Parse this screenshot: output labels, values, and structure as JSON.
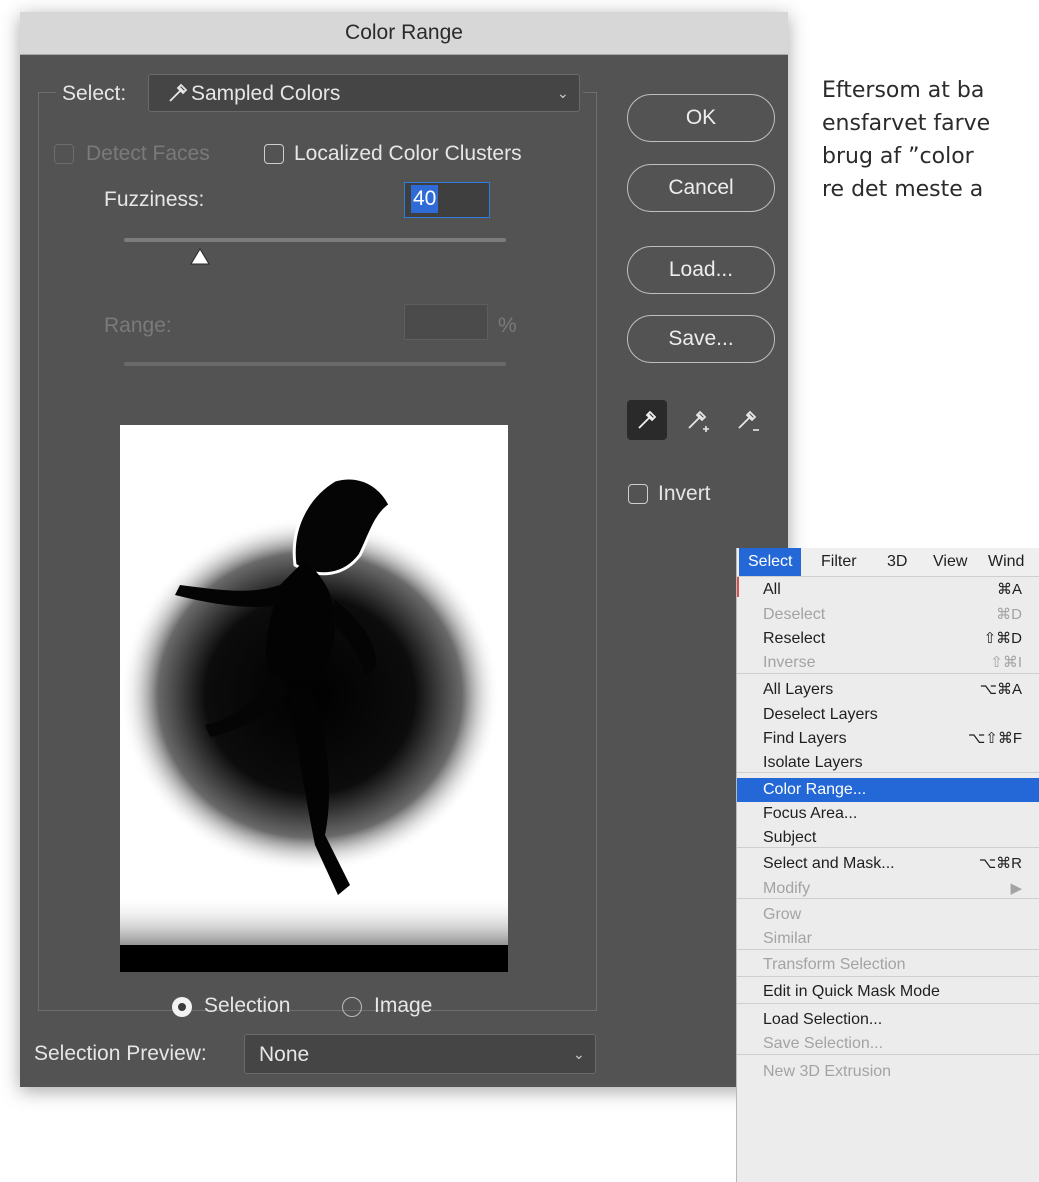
{
  "dialog": {
    "title": "Color Range",
    "select_label": "Select:",
    "select_value": "Sampled Colors",
    "detect_faces_label": "Detect Faces",
    "localized_label": "Localized Color Clusters",
    "fuzziness_label": "Fuzziness:",
    "fuzziness_value": "40",
    "range_label": "Range:",
    "range_unit": "%",
    "radio_selection_label": "Selection",
    "radio_image_label": "Image",
    "selection_preview_label": "Selection Preview:",
    "selection_preview_value": "None",
    "ok_label": "OK",
    "cancel_label": "Cancel",
    "load_label": "Load...",
    "save_label": "Save...",
    "invert_label": "Invert",
    "fuzziness_slider_level": 0.2
  },
  "side_text": [
    "Eftersom at ba",
    "ensfarvet farve",
    "brug af ”color",
    "re det meste a"
  ],
  "menu": {
    "bar": [
      "Select",
      "Filter",
      "3D",
      "View",
      "Wind"
    ],
    "items": [
      {
        "label": "All",
        "shortcut": "⌘A",
        "disabled": false
      },
      {
        "label": "Deselect",
        "shortcut": "⌘D",
        "disabled": true
      },
      {
        "label": "Reselect",
        "shortcut": "⇧⌘D",
        "disabled": false
      },
      {
        "label": "Inverse",
        "shortcut": "⇧⌘I",
        "disabled": true
      },
      {
        "label": "All Layers",
        "shortcut": "⌥⌘A",
        "disabled": false
      },
      {
        "label": "Deselect Layers",
        "shortcut": "",
        "disabled": false
      },
      {
        "label": "Find Layers",
        "shortcut": "⌥⇧⌘F",
        "disabled": false
      },
      {
        "label": "Isolate Layers",
        "shortcut": "",
        "disabled": false
      },
      {
        "label": "Color Range...",
        "shortcut": "",
        "disabled": false,
        "highlighted": true
      },
      {
        "label": "Focus Area...",
        "shortcut": "",
        "disabled": false
      },
      {
        "label": "Subject",
        "shortcut": "",
        "disabled": false
      },
      {
        "label": "Select and Mask...",
        "shortcut": "⌥⌘R",
        "disabled": false
      },
      {
        "label": "Modify",
        "shortcut": "▶",
        "disabled": true
      },
      {
        "label": "Grow",
        "shortcut": "",
        "disabled": true
      },
      {
        "label": "Similar",
        "shortcut": "",
        "disabled": true
      },
      {
        "label": "Transform Selection",
        "shortcut": "",
        "disabled": true
      },
      {
        "label": "Edit in Quick Mask Mode",
        "shortcut": "",
        "disabled": false
      },
      {
        "label": "Load Selection...",
        "shortcut": "",
        "disabled": false
      },
      {
        "label": "Save Selection...",
        "shortcut": "",
        "disabled": true
      },
      {
        "label": "New 3D Extrusion",
        "shortcut": "",
        "disabled": true
      }
    ]
  },
  "colors": {
    "dialog_bg": "#535353",
    "title_bar": "#d7d7d7",
    "highlight_blue": "#2468d8",
    "focus_blue": "#2f7fe0"
  },
  "icons": [
    "eyedropper-icon",
    "eyedropper-plus-icon",
    "eyedropper-minus-icon",
    "chevron-down-icon",
    "submenu-arrow-icon"
  ]
}
